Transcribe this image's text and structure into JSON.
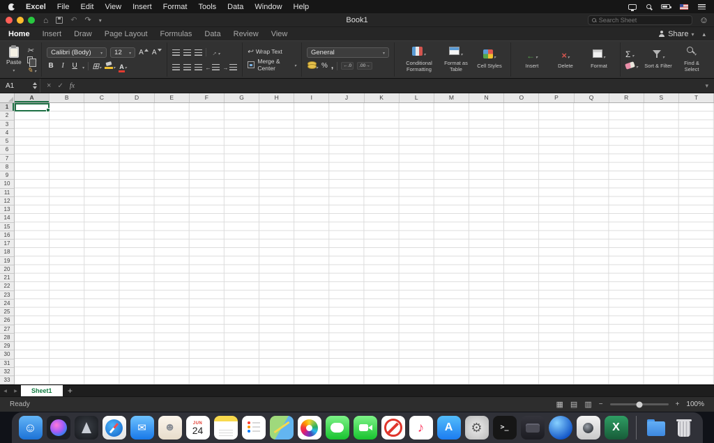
{
  "menu_bar": {
    "items": [
      "Excel",
      "File",
      "Edit",
      "View",
      "Insert",
      "Format",
      "Tools",
      "Data",
      "Window",
      "Help"
    ]
  },
  "title_bar": {
    "title": "Book1",
    "search": {
      "placeholder": "Search Sheet"
    }
  },
  "ribbon_tabs": {
    "tabs": [
      "Home",
      "Insert",
      "Draw",
      "Page Layout",
      "Formulas",
      "Data",
      "Review",
      "View"
    ],
    "active_tab": "Home",
    "share_label": "Share"
  },
  "ribbon": {
    "paste_label": "Paste",
    "font_name": "Calibri (Body)",
    "font_size": "12",
    "letter_a": "A",
    "bold": "B",
    "italic": "I",
    "underline": "U",
    "wrap_text_label": "Wrap Text",
    "merge_center_label": "Merge & Center",
    "number_format": "General",
    "percent_symbol": "%",
    "comma_symbol": ",",
    "decimal_decrease": "←.0",
    "decimal_increase": ".00→",
    "conditional_formatting_label": "Conditional Formatting",
    "format_as_table_label": "Format as Table",
    "cell_styles_label": "Cell Styles",
    "insert_label": "Insert",
    "delete_label": "Delete",
    "format_label": "Format",
    "sum_symbol": "Σ",
    "sort_filter_label": "Sort & Filter",
    "find_select_label": "Find & Select"
  },
  "formula_bar": {
    "name_box": "A1",
    "fx_label": "fx"
  },
  "grid": {
    "columns": [
      "A",
      "B",
      "C",
      "D",
      "E",
      "F",
      "G",
      "H",
      "I",
      "J",
      "K",
      "L",
      "M",
      "N",
      "O",
      "P",
      "Q",
      "R",
      "S",
      "T"
    ],
    "row_count": 33,
    "selected_cell": "A1",
    "selected_column": "A",
    "selected_row": "1"
  },
  "sheet_bar": {
    "active_sheet": "Sheet1",
    "add_label": "+"
  },
  "status_bar": {
    "status": "Ready",
    "zoom": "100%"
  },
  "colors": {
    "selection_green": "#1E7145",
    "sheet_tab_green": "#107C41",
    "excel_brand_green": "#217346",
    "ribbon_dark": "#323232",
    "titlebar_dark": "#262626"
  },
  "dock": {
    "items": [
      {
        "name": "finder",
        "cls": "ic-finder",
        "glyph": "☺"
      },
      {
        "name": "siri",
        "cls": "ic-siri"
      },
      {
        "name": "launchpad",
        "cls": "ic-launchpad"
      },
      {
        "name": "safari",
        "cls": "ic-safari"
      },
      {
        "name": "mail",
        "cls": "ic-mail",
        "glyph": "✉"
      },
      {
        "name": "contacts",
        "cls": "ic-contacts",
        "glyph": "☻"
      },
      {
        "name": "calendar",
        "cls": "ic-calendar",
        "month": "JUN",
        "day": "24"
      },
      {
        "name": "notes",
        "cls": "ic-notes"
      },
      {
        "name": "reminders",
        "cls": "ic-reminders"
      },
      {
        "name": "maps",
        "cls": "ic-maps"
      },
      {
        "name": "photos",
        "cls": "ic-photos"
      },
      {
        "name": "messages",
        "cls": "ic-messages"
      },
      {
        "name": "facetime",
        "cls": "ic-facetime"
      },
      {
        "name": "do-not-disturb",
        "cls": "ic-dnd"
      },
      {
        "name": "music",
        "cls": "ic-music",
        "glyph": "♪"
      },
      {
        "name": "app-store",
        "cls": "ic-appstore",
        "glyph": "A"
      },
      {
        "name": "system-preferences",
        "cls": "ic-settings",
        "glyph": "⚙"
      },
      {
        "name": "terminal",
        "cls": "ic-terminal",
        "glyph": ">_"
      },
      {
        "name": "code-editor",
        "cls": "ic-darkapp"
      },
      {
        "name": "network-utility",
        "cls": "ic-blueapp"
      },
      {
        "name": "image-capture",
        "cls": "ic-grayapp"
      },
      {
        "name": "excel",
        "cls": "ic-excel",
        "glyph": "X"
      },
      {
        "separator": true
      },
      {
        "name": "downloads-folder",
        "cls": "ic-folder"
      },
      {
        "name": "trash",
        "cls": "ic-trash"
      }
    ]
  }
}
